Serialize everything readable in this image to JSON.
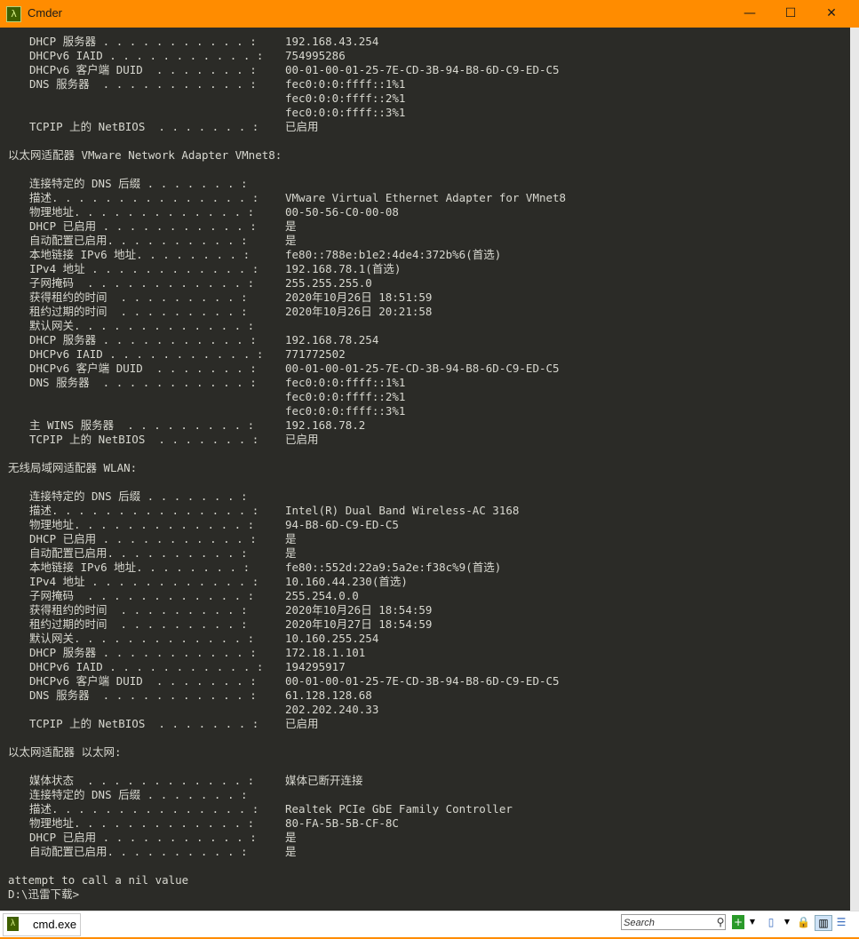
{
  "window": {
    "title": "Cmder",
    "minimize": "—",
    "maximize": "☐",
    "close": "✕",
    "app_icon": "λ"
  },
  "terminal": {
    "lines": [
      {
        "label": "DHCP 服务器 . . . . . . . . . . . :",
        "value": "192.168.43.254"
      },
      {
        "label": "DHCPv6 IAID . . . . . . . . . . . :",
        "value": "754995286"
      },
      {
        "label": "DHCPv6 客户端 DUID  . . . . . . . :",
        "value": "00-01-00-01-25-7E-CD-3B-94-B8-6D-C9-ED-C5"
      },
      {
        "label": "DNS 服务器  . . . . . . . . . . . :",
        "value": "fec0:0:0:ffff::1%1"
      },
      {
        "value": "fec0:0:0:ffff::2%1"
      },
      {
        "value": "fec0:0:0:ffff::3%1"
      },
      {
        "label": "TCPIP 上的 NetBIOS  . . . . . . . :",
        "value": "已启用"
      },
      {},
      {
        "header": "以太网适配器 VMware Network Adapter VMnet8:"
      },
      {},
      {
        "label": "连接特定的 DNS 后缀 . . . . . . . :",
        "value": ""
      },
      {
        "label": "描述. . . . . . . . . . . . . . . :",
        "value": "VMware Virtual Ethernet Adapter for VMnet8"
      },
      {
        "label": "物理地址. . . . . . . . . . . . . :",
        "value": "00-50-56-C0-00-08"
      },
      {
        "label": "DHCP 已启用 . . . . . . . . . . . :",
        "value": "是"
      },
      {
        "label": "自动配置已启用. . . . . . . . . . :",
        "value": "是"
      },
      {
        "label": "本地链接 IPv6 地址. . . . . . . . :",
        "value": "fe80::788e:b1e2:4de4:372b%6(首选)"
      },
      {
        "label": "IPv4 地址 . . . . . . . . . . . . :",
        "value": "192.168.78.1(首选)"
      },
      {
        "label": "子网掩码  . . . . . . . . . . . . :",
        "value": "255.255.255.0"
      },
      {
        "label": "获得租约的时间  . . . . . . . . . :",
        "value": "2020年10月26日 18:51:59"
      },
      {
        "label": "租约过期的时间  . . . . . . . . . :",
        "value": "2020年10月26日 20:21:58"
      },
      {
        "label": "默认网关. . . . . . . . . . . . . :",
        "value": ""
      },
      {
        "label": "DHCP 服务器 . . . . . . . . . . . :",
        "value": "192.168.78.254"
      },
      {
        "label": "DHCPv6 IAID . . . . . . . . . . . :",
        "value": "771772502"
      },
      {
        "label": "DHCPv6 客户端 DUID  . . . . . . . :",
        "value": "00-01-00-01-25-7E-CD-3B-94-B8-6D-C9-ED-C5"
      },
      {
        "label": "DNS 服务器  . . . . . . . . . . . :",
        "value": "fec0:0:0:ffff::1%1"
      },
      {
        "value": "fec0:0:0:ffff::2%1"
      },
      {
        "value": "fec0:0:0:ffff::3%1"
      },
      {
        "label": "主 WINS 服务器  . . . . . . . . . :",
        "value": "192.168.78.2"
      },
      {
        "label": "TCPIP 上的 NetBIOS  . . . . . . . :",
        "value": "已启用"
      },
      {},
      {
        "header": "无线局域网适配器 WLAN:"
      },
      {},
      {
        "label": "连接特定的 DNS 后缀 . . . . . . . :",
        "value": ""
      },
      {
        "label": "描述. . . . . . . . . . . . . . . :",
        "value": "Intel(R) Dual Band Wireless-AC 3168"
      },
      {
        "label": "物理地址. . . . . . . . . . . . . :",
        "value": "94-B8-6D-C9-ED-C5"
      },
      {
        "label": "DHCP 已启用 . . . . . . . . . . . :",
        "value": "是"
      },
      {
        "label": "自动配置已启用. . . . . . . . . . :",
        "value": "是"
      },
      {
        "label": "本地链接 IPv6 地址. . . . . . . . :",
        "value": "fe80::552d:22a9:5a2e:f38c%9(首选)"
      },
      {
        "label": "IPv4 地址 . . . . . . . . . . . . :",
        "value": "10.160.44.230(首选)"
      },
      {
        "label": "子网掩码  . . . . . . . . . . . . :",
        "value": "255.254.0.0"
      },
      {
        "label": "获得租约的时间  . . . . . . . . . :",
        "value": "2020年10月26日 18:54:59"
      },
      {
        "label": "租约过期的时间  . . . . . . . . . :",
        "value": "2020年10月27日 18:54:59"
      },
      {
        "label": "默认网关. . . . . . . . . . . . . :",
        "value": "10.160.255.254"
      },
      {
        "label": "DHCP 服务器 . . . . . . . . . . . :",
        "value": "172.18.1.101"
      },
      {
        "label": "DHCPv6 IAID . . . . . . . . . . . :",
        "value": "194295917"
      },
      {
        "label": "DHCPv6 客户端 DUID  . . . . . . . :",
        "value": "00-01-00-01-25-7E-CD-3B-94-B8-6D-C9-ED-C5"
      },
      {
        "label": "DNS 服务器  . . . . . . . . . . . :",
        "value": "61.128.128.68"
      },
      {
        "value": "202.202.240.33"
      },
      {
        "label": "TCPIP 上的 NetBIOS  . . . . . . . :",
        "value": "已启用"
      },
      {},
      {
        "header": "以太网适配器 以太网:"
      },
      {},
      {
        "label": "媒体状态  . . . . . . . . . . . . :",
        "value": "媒体已断开连接"
      },
      {
        "label": "连接特定的 DNS 后缀 . . . . . . . :",
        "value": ""
      },
      {
        "label": "描述. . . . . . . . . . . . . . . :",
        "value": "Realtek PCIe GbE Family Controller"
      },
      {
        "label": "物理地址. . . . . . . . . . . . . :",
        "value": "80-FA-5B-5B-CF-8C"
      },
      {
        "label": "DHCP 已启用 . . . . . . . . . . . :",
        "value": "是"
      },
      {
        "label": "自动配置已启用. . . . . . . . . . :",
        "value": "是"
      },
      {},
      {
        "header": "attempt to call a nil value"
      },
      {
        "header": "D:\\迅雷下载>"
      }
    ]
  },
  "statusbar": {
    "tab_label": "cmd.exe",
    "tab_icon": "λ",
    "search_placeholder": "Search",
    "icons": [
      "search-icon",
      "new-console-icon",
      "dropdown-icon",
      "split-icon",
      "dropdown-icon",
      "lock-icon",
      "buffer-icon",
      "menu-icon"
    ]
  },
  "colors": {
    "titlebar": "#ff8c00",
    "terminal_bg": "#2b2b27",
    "terminal_text": "#d8d8d0"
  }
}
